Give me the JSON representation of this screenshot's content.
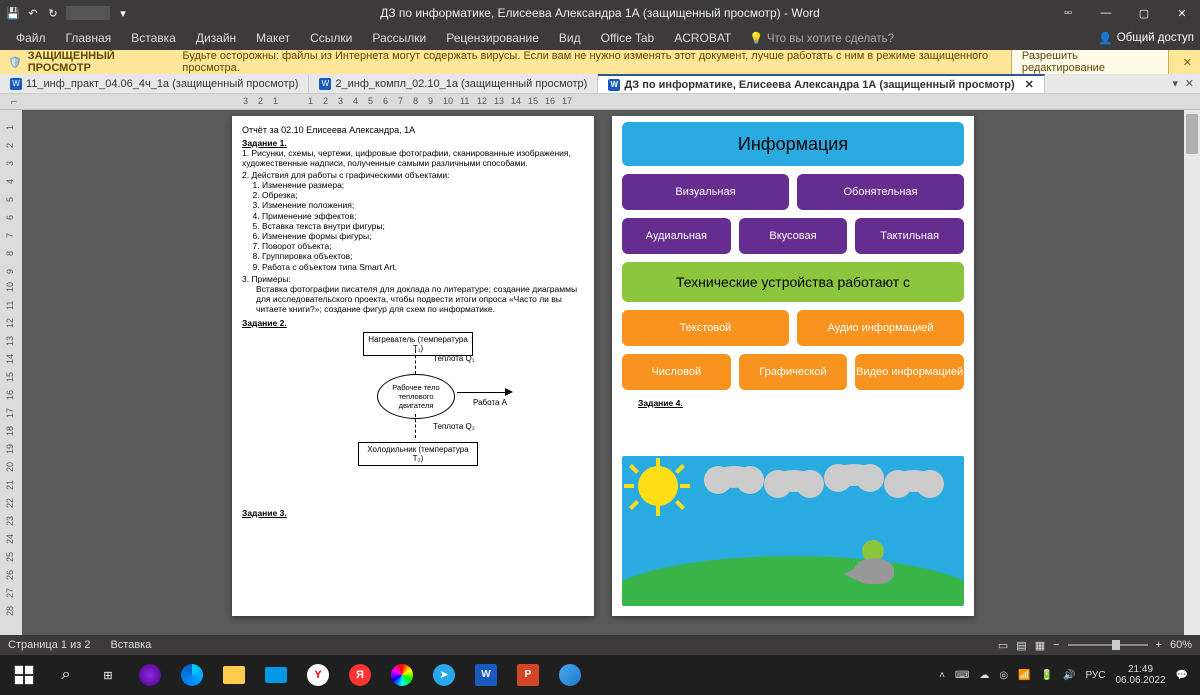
{
  "title": "ДЗ по информатике, Елисеева Александра 1А (защищенный просмотр) - Word",
  "ribbonTabs": [
    "Файл",
    "Главная",
    "Вставка",
    "Дизайн",
    "Макет",
    "Ссылки",
    "Рассылки",
    "Рецензирование",
    "Вид",
    "Office Tab",
    "ACROBAT"
  ],
  "tellMe": "Что вы хотите сделать?",
  "share": "Общий доступ",
  "protected": {
    "label": "ЗАЩИЩЕННЫЙ ПРОСМОТР",
    "msg": "Будьте осторожны: файлы из Интернета могут содержать вирусы. Если вам не нужно изменять этот документ, лучше работать с ним в режиме защищенного просмотра.",
    "allow": "Разрешить редактирование"
  },
  "docTabs": [
    {
      "label": "11_инф_практ_04.06_4ч_1а (защищенный просмотр)",
      "active": false
    },
    {
      "label": "2_инф_компл_02.10_1а (защищенный просмотр)",
      "active": false
    },
    {
      "label": "ДЗ по информатике, Елисеева Александра 1А (защищенный просмотр)",
      "active": true
    }
  ],
  "page1": {
    "header": "Отчёт за 02.10 Елисеева Александра, 1А",
    "t1": "Задание 1.",
    "p1": "1. Рисунки, схемы, чертежи, цифровые фотографии, сканированные изображения, художественные надписи, полученные самыми различными способами.",
    "p2": "2. Действия для работы с графическими объектами:",
    "list": [
      "Изменение размера;",
      "Обрезка;",
      "Изменение положения;",
      "Применение эффектов;",
      "Вставка текста внутри фигуры;",
      "Изменение формы фигуры;",
      "Поворот объекта;",
      "Группировка объектов;",
      "Работа с объектом типа Smart Art."
    ],
    "p3": "3. Примеры:",
    "p3b": "Вставка фотографии писателя для доклада по литературе; создание диаграммы для исследовательского проекта, чтобы подвести итоги опроса «Часто ли вы читаете книги?»; создание фигур для схем по информатике.",
    "t2": "Задание 2.",
    "d": {
      "heater": "Нагреватель (температура T₁)",
      "q1": "Теплота Q₁",
      "body": "Рабочее тело теплового двигателя",
      "work": "Работа A",
      "q2": "Теплота Q₂",
      "cooler": "Холодильник (температура T₂)"
    },
    "t3": "Задание 3."
  },
  "page2": {
    "info": "Информация",
    "row2": [
      "Визуальная",
      "Обонятельная"
    ],
    "row3": [
      "Аудиальная",
      "Вкусовая",
      "Тактильная"
    ],
    "tech": "Технические устройства работают с",
    "row4": [
      "Текстовой",
      "Аудио информацией"
    ],
    "row5": [
      "Числовой",
      "Графической",
      "Видео информацией"
    ],
    "t4": "Задание 4."
  },
  "status": {
    "page": "Страница 1 из 2",
    "section": "Вставка",
    "zoom": "60%"
  },
  "sys": {
    "lang": "РУС",
    "time": "21:49",
    "date": "06.06.2022"
  }
}
